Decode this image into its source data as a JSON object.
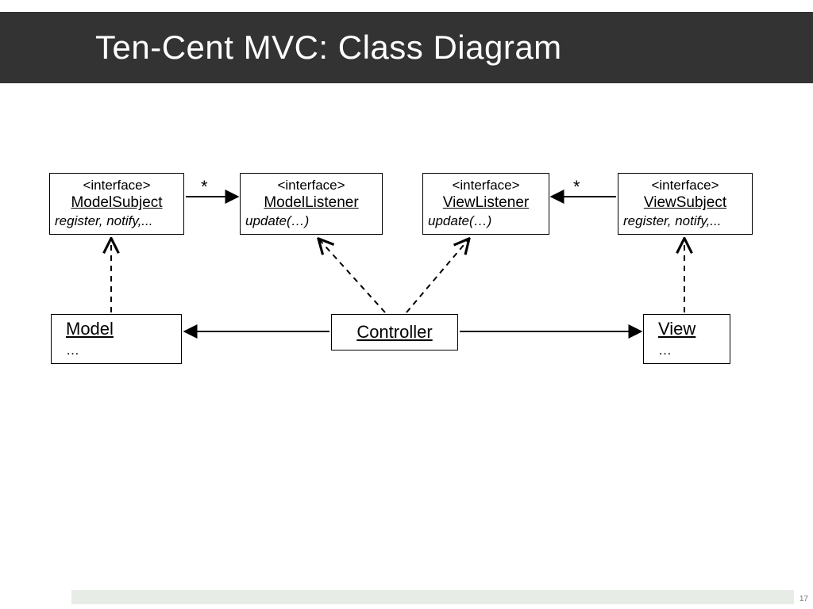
{
  "slide": {
    "title": "Ten-Cent MVC: Class Diagram",
    "page_number": "17"
  },
  "interfaces": {
    "model_subject": {
      "stereotype": "<interface>",
      "name": "ModelSubject",
      "ops": "register, notify,..."
    },
    "model_listener": {
      "stereotype": "<interface>",
      "name": "ModelListener",
      "ops": "update(…)"
    },
    "view_listener": {
      "stereotype": "<interface>",
      "name": "ViewListener",
      "ops": "update(…)"
    },
    "view_subject": {
      "stereotype": "<interface>",
      "name": "ViewSubject",
      "ops": "register, notify,..."
    }
  },
  "classes": {
    "model": {
      "name": "Model",
      "ops": "…"
    },
    "controller": {
      "name": "Controller"
    },
    "view": {
      "name": "View",
      "ops": "…"
    }
  },
  "multiplicities": {
    "left": "*",
    "right": "*"
  }
}
